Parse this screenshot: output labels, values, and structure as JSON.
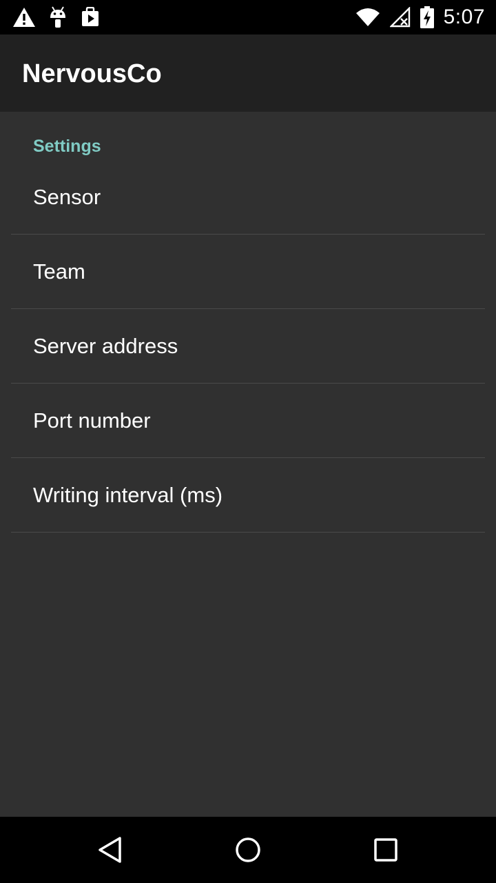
{
  "status_bar": {
    "time": "5:07",
    "left_icons": [
      "warning-icon",
      "android-debug-icon",
      "play-store-icon"
    ],
    "right_icons": [
      "wifi-icon",
      "signal-off-icon",
      "battery-charging-icon"
    ]
  },
  "app_bar": {
    "title": "NervousCo"
  },
  "settings": {
    "category_label": "Settings",
    "items": [
      {
        "label": "Sensor"
      },
      {
        "label": "Team"
      },
      {
        "label": "Server address"
      },
      {
        "label": "Port number"
      },
      {
        "label": "Writing interval (ms)"
      }
    ]
  },
  "nav_bar": {
    "buttons": [
      "back-icon",
      "home-icon",
      "recents-icon"
    ]
  },
  "colors": {
    "accent": "#80cbc4",
    "background": "#303030",
    "app_bar": "#212121"
  }
}
